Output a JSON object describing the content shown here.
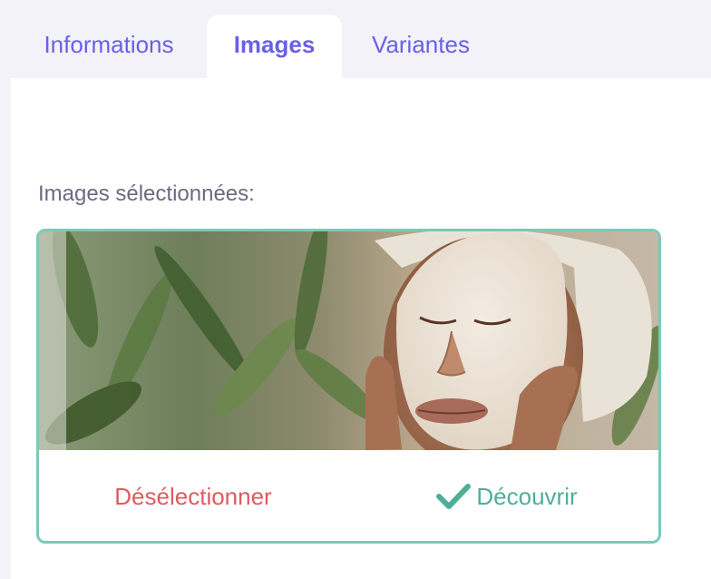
{
  "tabs": {
    "informations": "Informations",
    "images": "Images",
    "variantes": "Variantes",
    "active": "images"
  },
  "panel": {
    "selected_label": "Images sélectionnées:"
  },
  "card": {
    "image_alt": "woman with facial mask and towel",
    "deselect_label": "Désélectionner",
    "discover_label": "Découvrir",
    "discover_icon": "check-icon"
  },
  "colors": {
    "accent": "#6b5fe6",
    "card_border": "#7cc9b8",
    "deselect": "#de5b62",
    "discover": "#4fae98"
  }
}
